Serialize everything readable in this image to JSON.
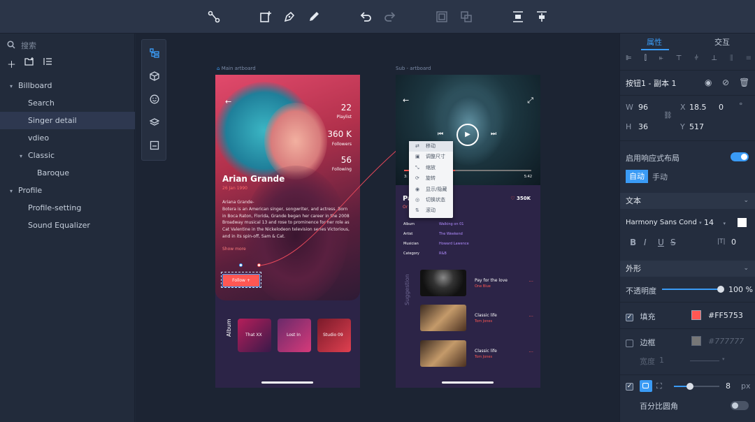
{
  "toolbar": {
    "icons": [
      "connect-icon",
      "add-frame-icon",
      "pen-icon",
      "pencil-icon",
      "undo-icon",
      "redo-icon",
      "group-icon",
      "ungroup-icon",
      "distribute-vertical-icon",
      "distribute-horizontal-icon"
    ]
  },
  "left_panel": {
    "search_placeholder": "搜索",
    "tree": [
      {
        "label": "Billboard",
        "expanded": true
      },
      {
        "label": "Search"
      },
      {
        "label": "Singer detail",
        "selected": true
      },
      {
        "label": "vdieo"
      },
      {
        "label": "Classic",
        "expanded": true
      },
      {
        "label": "Baroque"
      },
      {
        "label": "Profile",
        "expanded": true
      },
      {
        "label": "Profile-setting"
      },
      {
        "label": "Sound Equalizer"
      }
    ]
  },
  "canvas": {
    "main_artboard_label": "Main artboard",
    "sub_artboard_label": "Sub - artboard",
    "singer": {
      "playlist_count": "22",
      "playlist_label": "Playlist",
      "followers_count": "360 K",
      "followers_label": "Followers",
      "following_count": "56",
      "following_label": "Following",
      "name": "Arian Grande",
      "date": "26 Jan 1990",
      "bio": "Ariana Grande-\nBotera is an American singer, songwriter, and actress. Born in Boca Raton, Florida, Grande began her career in the 2008 Broadway musical 13 and rose to prominence for her role as Cat Valentine in the Nickelodeon television series Victorious, and in its spin-off, Sam & Cat.",
      "show_more": "Show more",
      "follow_button": "Follow +",
      "album_label": "Album",
      "albums": [
        "That XX",
        "Lost In",
        "Studio 09"
      ]
    },
    "player": {
      "time_start": "3:",
      "time_end": "5:42",
      "title_prefix": "Pa",
      "subtitle_prefix": "Or",
      "likes": "350K",
      "details": [
        {
          "key": "Album",
          "value": "Walking on 01"
        },
        {
          "key": "Artist",
          "value": "The Weekend"
        },
        {
          "key": "Musician",
          "value": "Howard Lawence"
        },
        {
          "key": "Category",
          "value": "R&B"
        }
      ],
      "suggestion_label": "Suggestion",
      "suggestions": [
        {
          "title": "Pay for the love",
          "artist": "One Blue"
        },
        {
          "title": "Classic life",
          "artist": "Tom Jones"
        },
        {
          "title": "Classic life",
          "artist": "Tom Jones"
        }
      ],
      "more": "..."
    },
    "context_menu": [
      "移动",
      "调整尺寸",
      "缩放",
      "旋转",
      "显示/隐藏",
      "切换状态",
      "滚动"
    ]
  },
  "right_panel": {
    "tab_properties": "属性",
    "tab_interaction": "交互",
    "layer_name": "按钮1 - 副本 1",
    "w_label": "W",
    "w_value": "96",
    "x_label": "X",
    "x_value": "18.5",
    "rotation_value": "0",
    "degree": "°",
    "h_label": "H",
    "h_value": "36",
    "y_label": "Y",
    "y_value": "517",
    "responsive_label": "启用响应式布局",
    "responsive_on": true,
    "auto_label": "自动",
    "manual_label": "手动",
    "text_section": "文本",
    "font_family": "Harmony Sans Cond",
    "font_size": "14",
    "bold": "B",
    "italic": "I",
    "underline": "U",
    "strike": "S",
    "letter_spacing_icon": "|T|",
    "letter_spacing": "0",
    "appearance_section": "外形",
    "opacity_label": "不透明度",
    "opacity_value": "100 %",
    "opacity": 1.0,
    "fill_label": "填充",
    "fill_checked": true,
    "fill_color": "#FF5753",
    "border_label": "边框",
    "border_checked": false,
    "border_color": "#777777",
    "width_label": "宽度",
    "width_value": "1",
    "radius_value": "8",
    "radius_unit": "px",
    "radius_slider": 0.35,
    "percent_radius_label": "百分比圆角",
    "percent_radius_on": false
  },
  "colors": {
    "accent": "#3a9bf5",
    "brand_red": "#ff5753",
    "artboard_bg": "#2c2447"
  }
}
